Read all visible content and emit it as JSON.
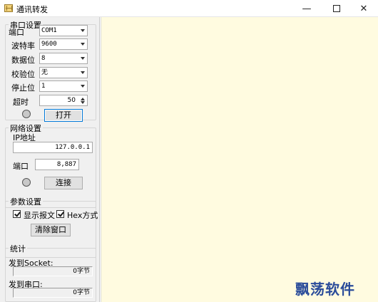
{
  "window": {
    "title": "通讯转发"
  },
  "serial": {
    "group_title": "串口设置",
    "port_label": "端口",
    "port_value": "COM1",
    "baud_label": "波特率",
    "baud_value": "9600",
    "databits_label": "数据位",
    "databits_value": "8",
    "parity_label": "校验位",
    "parity_value": "无",
    "stopbits_label": "停止位",
    "stopbits_value": "1",
    "timeout_label": "超时",
    "timeout_value": "50",
    "open_button": "打开"
  },
  "network": {
    "group_title": "网络设置",
    "ip_label": "IP地址",
    "ip_value": "127.0.0.1",
    "port_label": "端口",
    "port_value": "8,887",
    "connect_button": "连接"
  },
  "params": {
    "group_title": "参数设置",
    "show_message_label": "显示报文",
    "hex_mode_label": "Hex方式",
    "clear_button": "清除窗口"
  },
  "stats": {
    "group_title": "统计",
    "to_socket_label": "发到Socket:",
    "to_socket_value": "0字节",
    "to_serial_label": "发到串口:",
    "to_serial_value": "0字节"
  },
  "watermark": "飘荡软件"
}
